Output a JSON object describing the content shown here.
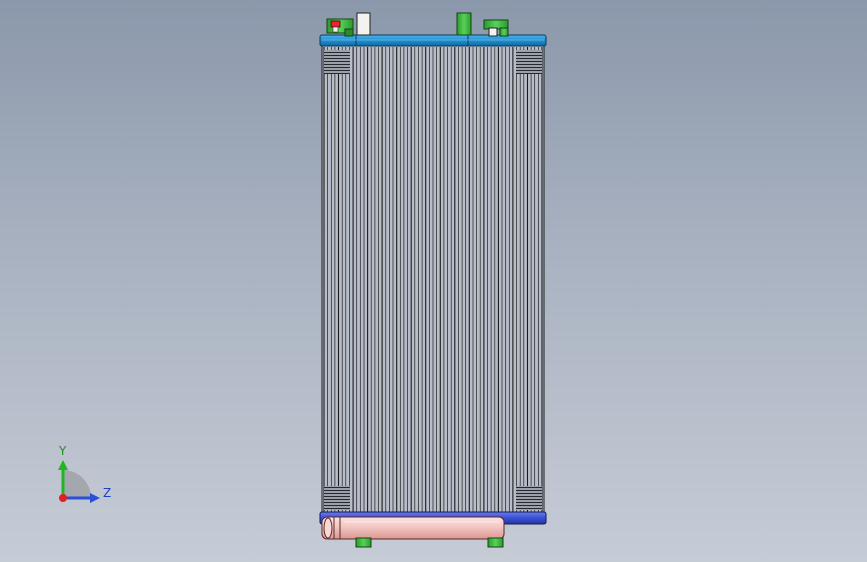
{
  "viewport": {
    "background_top": "#8b98ab",
    "background_bottom": "#c6ccd6"
  },
  "model": {
    "part": "condenser-radiator",
    "core_stroke_color": "#1a1a1a",
    "core_fill_color": "#b8bec9",
    "top_header_color": "#1e8fd0",
    "bottom_header_color": "#3a4fd6",
    "receiver_drier_color": "#f3c6c2",
    "fitting_color": "#3fbf3f",
    "tube_count": 60
  },
  "triad": {
    "y_label": "Y",
    "z_label": "Z",
    "y_color": "#22b522",
    "z_color": "#2a4fd8",
    "x_color": "#e02020"
  }
}
